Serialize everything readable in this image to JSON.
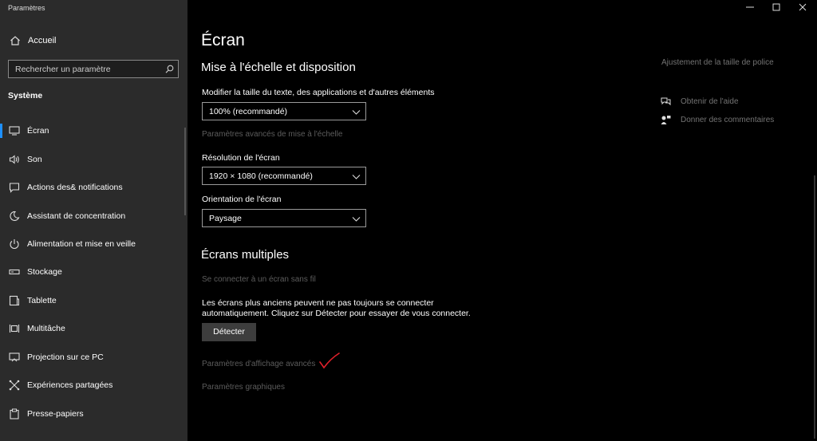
{
  "window": {
    "title": "Paramètres"
  },
  "sidebar": {
    "home_label": "Accueil",
    "search_placeholder": "Rechercher un paramètre",
    "section": "Système",
    "items": [
      {
        "label": "Écran",
        "icon": "monitor-icon",
        "selected": true
      },
      {
        "label": "Son",
        "icon": "speaker-icon"
      },
      {
        "label": "Actions des& notifications",
        "icon": "notification-icon"
      },
      {
        "label": "Assistant de concentration",
        "icon": "moon-icon"
      },
      {
        "label": "Alimentation et mise en veille",
        "icon": "power-icon"
      },
      {
        "label": "Stockage",
        "icon": "storage-icon"
      },
      {
        "label": "Tablette",
        "icon": "tablet-icon"
      },
      {
        "label": "Multitâche",
        "icon": "multitask-icon"
      },
      {
        "label": "Projection sur ce PC",
        "icon": "projection-icon"
      },
      {
        "label": "Expériences partagées",
        "icon": "shared-icon"
      },
      {
        "label": "Presse-papiers",
        "icon": "clipboard-icon"
      }
    ]
  },
  "main": {
    "title": "Écran",
    "scale_section": "Mise à l'échelle et disposition",
    "scale_label": "Modifier la taille du texte, des applications et d'autres éléments",
    "scale_value": "100% (recommandé)",
    "scale_advanced_link": "Paramètres avancés de mise à l'échelle",
    "resolution_label": "Résolution de l'écran",
    "resolution_value": "1920 × 1080 (recommandé)",
    "orientation_label": "Orientation de l'écran",
    "orientation_value": "Paysage",
    "multi_section": "Écrans multiples",
    "wireless_link": "Se connecter à un écran sans fil",
    "detect_text_1": "Les écrans plus anciens peuvent ne pas toujours se connecter",
    "detect_text_2": "automatiquement. Cliquez sur Détecter pour essayer de vous connecter.",
    "detect_button": "Détecter",
    "advanced_display_link": "Paramètres d'affichage avancés",
    "graphics_link": "Paramètres graphiques"
  },
  "related": {
    "font_size_link": "Ajustement de la taille de police",
    "help_link": "Obtenir de l'aide",
    "feedback_link": "Donner des commentaires"
  },
  "colors": {
    "accent": "#1e90ff",
    "sidebar_bg": "#2b2b2b",
    "annotation_check": "#e0202a"
  }
}
